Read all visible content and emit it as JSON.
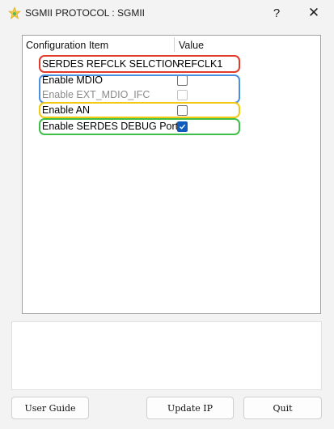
{
  "window": {
    "title": "SGMII PROTOCOL : SGMII",
    "help_label": "?",
    "close_label": "✕"
  },
  "table": {
    "columns": [
      "Configuration Item",
      "Value"
    ],
    "rows": [
      {
        "label": "SERDES REFCLK SELCTION",
        "value": "REFCLK1",
        "type": "text",
        "enabled": true
      },
      {
        "label": "Enable MDIO",
        "checked": false,
        "type": "checkbox",
        "enabled": true
      },
      {
        "label": "Enable EXT_MDIO_IFC",
        "checked": false,
        "type": "checkbox",
        "enabled": false
      },
      {
        "label": "Enable AN",
        "checked": false,
        "type": "checkbox",
        "enabled": true
      },
      {
        "label": "Enable SERDES DEBUG Port",
        "checked": true,
        "type": "checkbox",
        "enabled": true
      }
    ]
  },
  "highlight_colors": {
    "red": "#e23b2a",
    "blue": "#4a90e2",
    "yellow": "#f2c811",
    "green": "#3fbf4a"
  },
  "log": {
    "text": ""
  },
  "buttons": {
    "user_guide": "User Guide",
    "update_ip": "Update IP",
    "quit": "Quit"
  },
  "icons": {
    "app": "star-app-icon",
    "help": "help-icon",
    "close": "close-icon",
    "check": "checkmark-icon"
  }
}
